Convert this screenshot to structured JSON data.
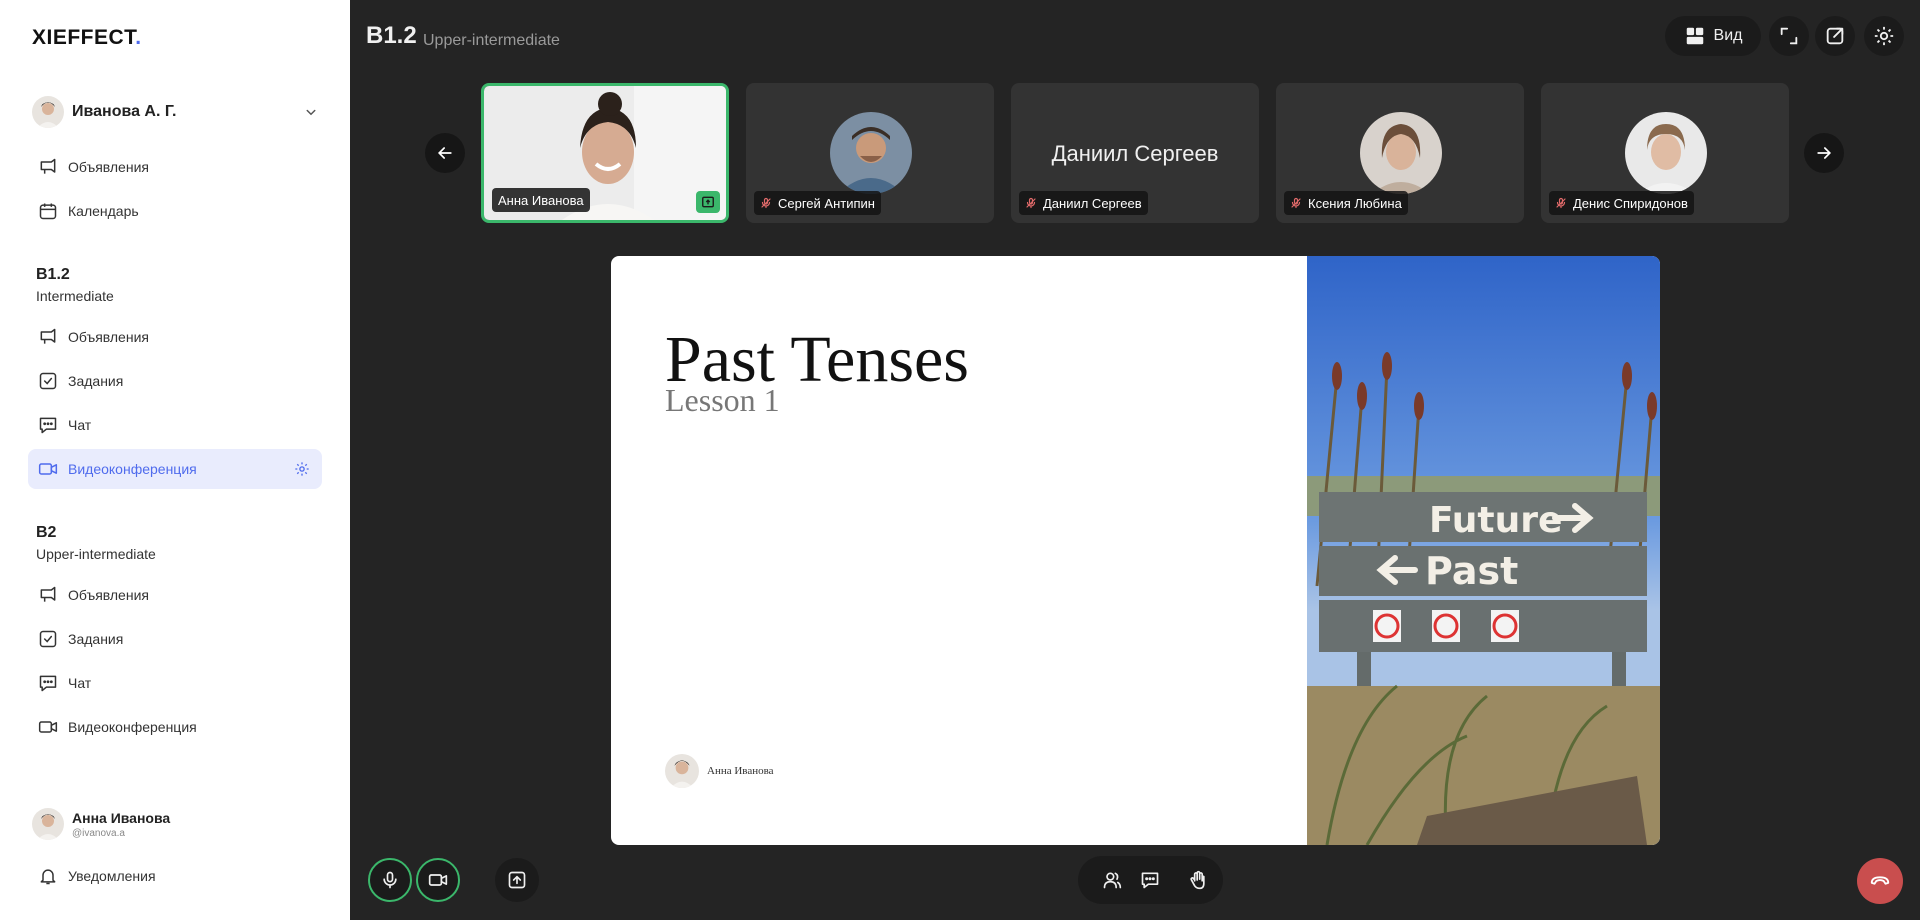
{
  "app": {
    "logo_text": "XIEFFECT",
    "logo_dot": "."
  },
  "sidebar": {
    "user_select": {
      "name": "Иванова А. Г."
    },
    "top_items": [
      {
        "label": "Объявления",
        "icon": "announcement-icon"
      },
      {
        "label": "Календарь",
        "icon": "calendar-icon"
      }
    ],
    "groups": [
      {
        "title": "B1.2",
        "subtitle": "Intermediate",
        "items": [
          {
            "label": "Объявления",
            "icon": "announcement-icon"
          },
          {
            "label": "Задания",
            "icon": "task-icon"
          },
          {
            "label": "Чат",
            "icon": "chat-icon"
          },
          {
            "label": "Видеоконференция",
            "icon": "video-icon",
            "active": true
          }
        ]
      },
      {
        "title": "B2",
        "subtitle": "Upper-intermediate",
        "items": [
          {
            "label": "Объявления",
            "icon": "announcement-icon"
          },
          {
            "label": "Задания",
            "icon": "task-icon"
          },
          {
            "label": "Чат",
            "icon": "chat-icon"
          },
          {
            "label": "Видеоконференция",
            "icon": "video-icon"
          }
        ]
      }
    ],
    "bottom_user": {
      "name": "Анна Иванова",
      "handle": "@ivanova.a"
    },
    "notifications_label": "Уведомления"
  },
  "header": {
    "title": "B1.2",
    "subtitle": "Upper-intermediate",
    "view_label": "Вид"
  },
  "participants": [
    {
      "name": "Анна Иванова",
      "muted": false,
      "active": true,
      "sharing": true
    },
    {
      "name": "Сергей Антипин",
      "muted": true
    },
    {
      "name": "Даниил Сергеев",
      "muted": true,
      "no_video": true
    },
    {
      "name": "Ксения Любина",
      "muted": true
    },
    {
      "name": "Денис Спиридонов",
      "muted": true
    }
  ],
  "slide": {
    "title": "Past Tenses",
    "subtitle": "Lesson 1",
    "author": "Анна Иванова",
    "sign_top": "Future",
    "sign_bottom": "Past"
  },
  "colors": {
    "accent": "#4f6bed",
    "active_border": "#3bb76b",
    "hangup": "#c94e4e",
    "background": "#242424"
  }
}
